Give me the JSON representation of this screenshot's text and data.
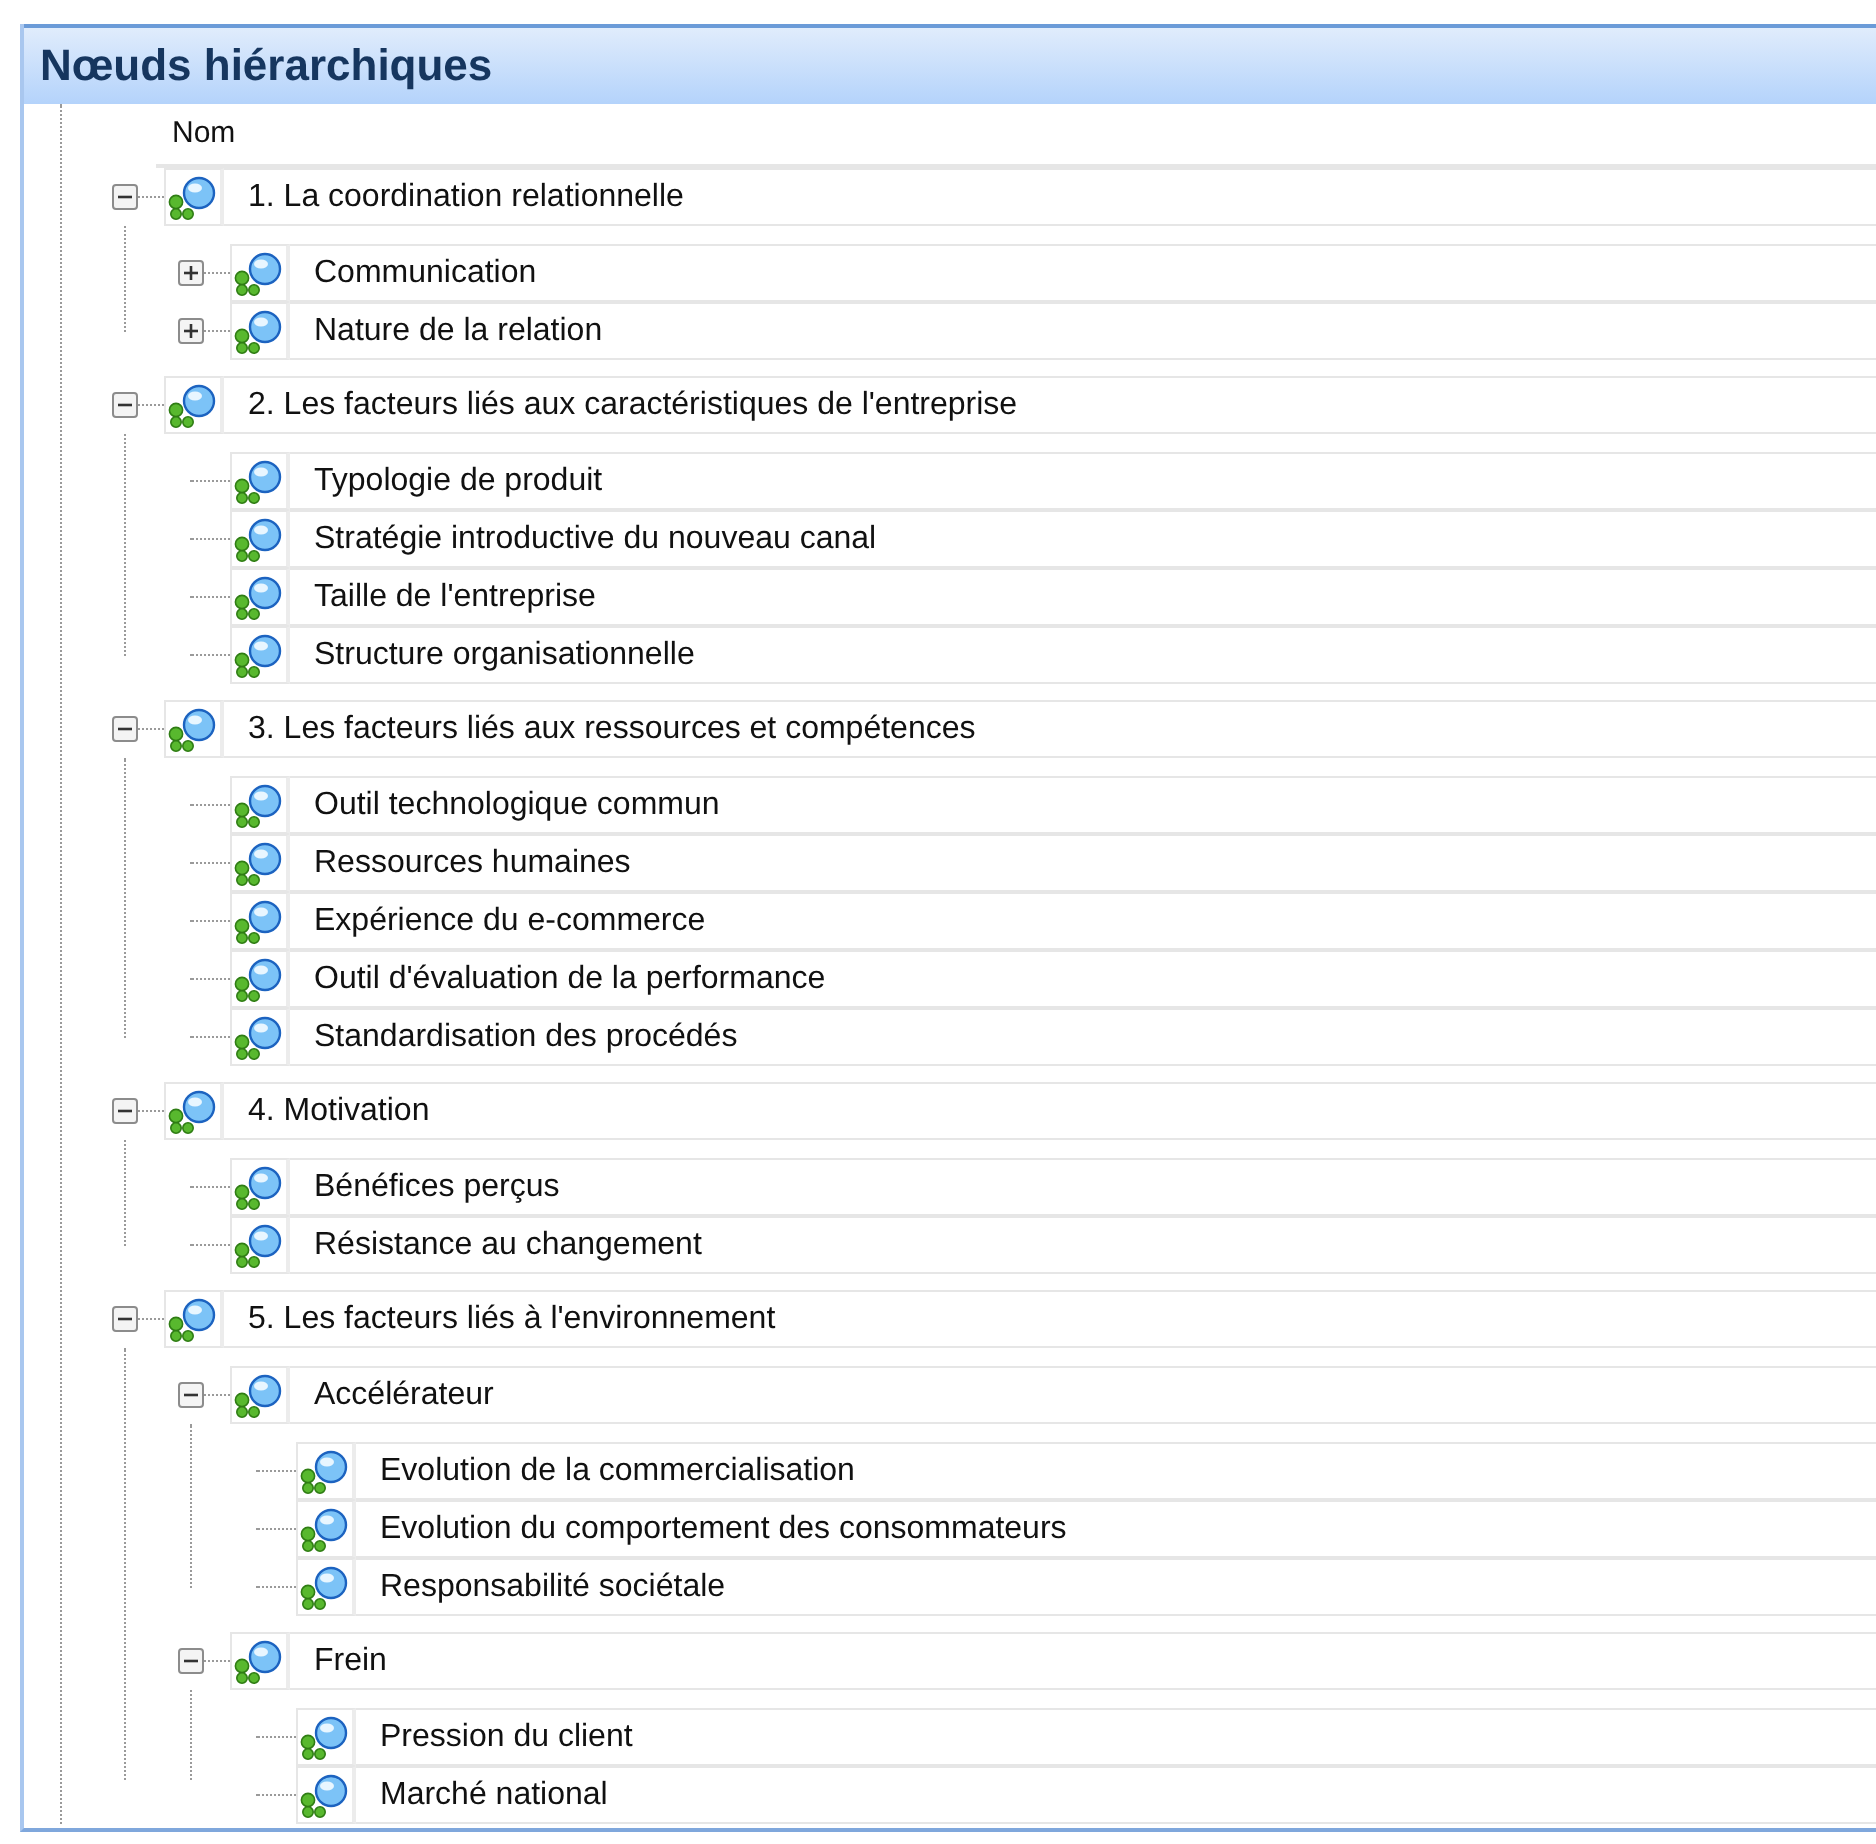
{
  "panel": {
    "title": "Nœuds hiérarchiques"
  },
  "table": {
    "columns": [
      "Nom"
    ]
  },
  "tree": [
    {
      "label": "1. La coordination relationnelle",
      "kind": "branch",
      "expanded": true,
      "children": [
        {
          "label": "Communication",
          "kind": "branch",
          "expanded": false
        },
        {
          "label": "Nature de la relation",
          "kind": "branch",
          "expanded": false
        }
      ]
    },
    {
      "label": "2. Les facteurs liés aux caractéristiques de l'entreprise",
      "kind": "branch",
      "expanded": true,
      "children": [
        {
          "label": "Typologie de produit",
          "kind": "leaf"
        },
        {
          "label": "Stratégie introductive du nouveau canal",
          "kind": "leaf"
        },
        {
          "label": "Taille de l'entreprise",
          "kind": "leaf"
        },
        {
          "label": "Structure organisationnelle",
          "kind": "leaf"
        }
      ]
    },
    {
      "label": "3. Les facteurs liés aux ressources et compétences",
      "kind": "branch",
      "expanded": true,
      "children": [
        {
          "label": "Outil technologique commun",
          "kind": "leaf"
        },
        {
          "label": "Ressources humaines",
          "kind": "leaf"
        },
        {
          "label": "Expérience du e-commerce",
          "kind": "leaf"
        },
        {
          "label": "Outil d'évaluation de la performance",
          "kind": "leaf"
        },
        {
          "label": "Standardisation des procédés",
          "kind": "leaf"
        }
      ]
    },
    {
      "label": "4. Motivation",
      "kind": "branch",
      "expanded": true,
      "children": [
        {
          "label": "Bénéfices perçus",
          "kind": "leaf"
        },
        {
          "label": "Résistance au changement",
          "kind": "leaf"
        }
      ]
    },
    {
      "label": "5. Les facteurs liés à l'environnement",
      "kind": "branch",
      "expanded": true,
      "children": [
        {
          "label": "Accélérateur",
          "kind": "branch",
          "expanded": true,
          "children": [
            {
              "label": "Evolution de la commercialisation",
              "kind": "leaf"
            },
            {
              "label": "Evolution du comportement des consommateurs",
              "kind": "leaf"
            },
            {
              "label": "Responsabilité sociétale",
              "kind": "leaf"
            }
          ]
        },
        {
          "label": "Frein",
          "kind": "branch",
          "expanded": true,
          "children": [
            {
              "label": "Pression du client",
              "kind": "leaf"
            },
            {
              "label": "Marché national",
              "kind": "leaf"
            }
          ]
        }
      ]
    }
  ]
}
